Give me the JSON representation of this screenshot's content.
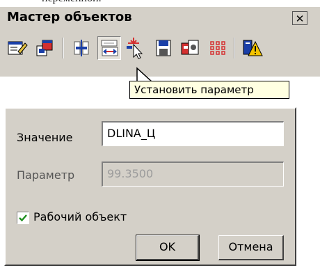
{
  "clipped_text": "переменной.",
  "toolbar": {
    "title": "Мастер объектов",
    "close_glyph": "✕",
    "buttons": [
      {
        "icon": "edit-object-icon"
      },
      {
        "icon": "object-properties-icon"
      },
      {
        "icon": "align-objects-icon"
      },
      {
        "icon": "set-parameter-icon",
        "pressed": true
      },
      {
        "icon": "select-object-icon"
      },
      {
        "icon": "save-object-icon"
      },
      {
        "icon": "object-library-icon"
      },
      {
        "icon": "grid-icon"
      },
      {
        "icon": "warning-settings-icon"
      }
    ]
  },
  "tooltip": {
    "text": "Установить параметр"
  },
  "dialog": {
    "value_label": "Значение",
    "value_input": "DLINA_Ц",
    "param_label": "Параметр",
    "param_input": "99.3500",
    "work_object_label": "Рабочий объект",
    "work_object_checked": true,
    "ok_label": "OK",
    "cancel_label": "Отмена"
  },
  "colors": {
    "face": "#d4d0c8",
    "tooltip_bg": "#ffffe1",
    "check_color": "#1e8f1e"
  }
}
